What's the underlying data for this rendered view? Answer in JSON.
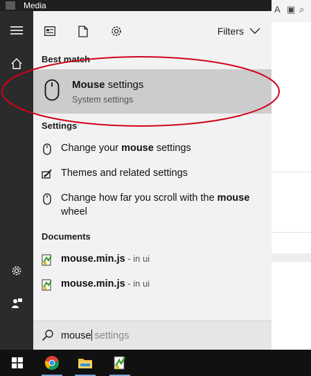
{
  "background_app": {
    "title": "Media"
  },
  "search_panel": {
    "header": {
      "filters_label": "Filters"
    },
    "best_match": {
      "heading": "Best match",
      "item": {
        "title_bold": "Mouse",
        "title_rest": " settings",
        "subtitle": "System settings"
      }
    },
    "settings": {
      "heading": "Settings",
      "items": [
        {
          "pre": "Change your ",
          "bold": "mouse",
          "post": " settings",
          "icon": "mouse-icon"
        },
        {
          "pre": "Themes and related settings",
          "bold": "",
          "post": "",
          "icon": "theme-brush-icon"
        },
        {
          "pre": "Change how far you scroll with the ",
          "bold": "mouse",
          "post": " wheel",
          "icon": "mouse-icon"
        }
      ]
    },
    "documents": {
      "heading": "Documents",
      "items": [
        {
          "name": "mouse.min.js",
          "location": " - in ui"
        },
        {
          "name": "mouse.min.js",
          "location": " - in ui"
        }
      ]
    },
    "search_box": {
      "typed": "mouse",
      "suggestion": " settings"
    }
  },
  "colors": {
    "annotation": "#d0021b",
    "highlight": "#cccccc",
    "panel_bg": "#f2f2f2",
    "rail_bg": "#2b2b2b",
    "taskbar_bg": "#111111"
  }
}
